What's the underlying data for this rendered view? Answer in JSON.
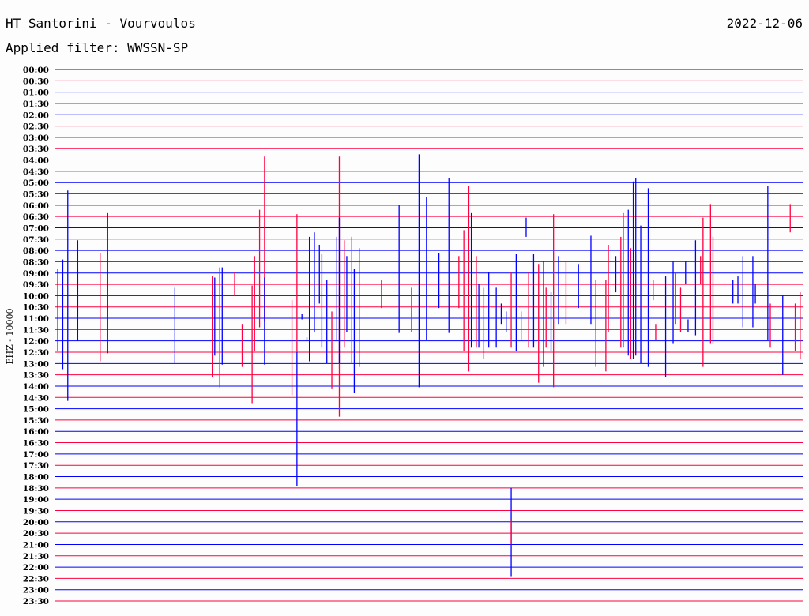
{
  "header": {
    "station": "HT Santorini - Vourvoulos",
    "date": "2022-12-06",
    "filter": "Applied filter: WWSSN-SP"
  },
  "colors": {
    "b": "#0000ff",
    "r": "#ff0040"
  },
  "chart_data": {
    "type": "helicorder",
    "ylabel": "EHZ - 10000",
    "minutes_per_line": 30,
    "tick_labels": [
      "00:00",
      "00:30",
      "01:00",
      "01:30",
      "02:00",
      "02:30",
      "03:00",
      "03:30",
      "04:00",
      "04:30",
      "05:00",
      "05:30",
      "06:00",
      "06:30",
      "07:00",
      "07:30",
      "08:00",
      "08:30",
      "09:00",
      "09:30",
      "10:00",
      "10:30",
      "11:00",
      "11:30",
      "12:00",
      "12:30",
      "13:00",
      "13:30",
      "14:00",
      "14:30",
      "15:00",
      "15:30",
      "16:00",
      "16:30",
      "17:00",
      "17:30",
      "18:00",
      "18:30",
      "19:00",
      "19:30",
      "20:00",
      "20:30",
      "21:00",
      "21:30",
      "22:00",
      "22:30",
      "23:00",
      "23:30"
    ],
    "trace_colors": [
      "b",
      "r"
    ],
    "spikes_note": "[minute within line, top, bottom (in trace-line units from 00:00), color]",
    "spikes": [
      [
        0.1,
        17.6,
        24.9,
        "b"
      ],
      [
        0.3,
        16.8,
        26.5,
        "b"
      ],
      [
        0.5,
        10.7,
        29.3,
        "b"
      ],
      [
        0.9,
        17.6,
        21.8,
        "b"
      ],
      [
        0.9,
        15.1,
        24.0,
        "b"
      ],
      [
        1.8,
        16.2,
        25.8,
        "r"
      ],
      [
        2.1,
        12.7,
        25.1,
        "b"
      ],
      [
        4.8,
        19.3,
        26.0,
        "b"
      ],
      [
        6.3,
        18.3,
        27.2,
        "r"
      ],
      [
        6.4,
        18.4,
        25.3,
        "b"
      ],
      [
        6.6,
        17.5,
        28.1,
        "r"
      ],
      [
        6.7,
        17.5,
        26.1,
        "b"
      ],
      [
        7.2,
        17.9,
        20.0,
        "r"
      ],
      [
        7.5,
        22.5,
        26.3,
        "r"
      ],
      [
        7.9,
        19.1,
        29.5,
        "r"
      ],
      [
        8.0,
        16.5,
        24.9,
        "r"
      ],
      [
        8.2,
        12.4,
        22.8,
        "r"
      ],
      [
        8.4,
        7.7,
        22.3,
        "r"
      ],
      [
        8.4,
        18.4,
        26.1,
        "b"
      ],
      [
        9.5,
        20.4,
        28.8,
        "r"
      ],
      [
        9.7,
        12.8,
        25.0,
        "r"
      ],
      [
        9.7,
        25.0,
        36.8,
        "b"
      ],
      [
        9.9,
        21.6,
        22.1,
        "b"
      ],
      [
        10.1,
        23.7,
        24.0,
        "b"
      ],
      [
        10.2,
        14.8,
        25.8,
        "b"
      ],
      [
        10.4,
        14.4,
        23.2,
        "b"
      ],
      [
        10.6,
        15.5,
        20.7,
        "b"
      ],
      [
        10.7,
        16.3,
        24.6,
        "b"
      ],
      [
        10.9,
        18.6,
        26.0,
        "b"
      ],
      [
        11.1,
        21.4,
        28.2,
        "r"
      ],
      [
        11.3,
        14.8,
        23.9,
        "b"
      ],
      [
        11.4,
        7.7,
        30.7,
        "r"
      ],
      [
        11.4,
        13.1,
        26.0,
        "b"
      ],
      [
        11.6,
        15.1,
        24.6,
        "r"
      ],
      [
        11.7,
        16.5,
        23.2,
        "b"
      ],
      [
        11.9,
        14.8,
        26.0,
        "r"
      ],
      [
        12.0,
        17.6,
        28.6,
        "b"
      ],
      [
        12.2,
        15.8,
        26.3,
        "b"
      ],
      [
        13.1,
        18.6,
        21.1,
        "b"
      ],
      [
        13.8,
        12.0,
        23.3,
        "b"
      ],
      [
        14.3,
        19.3,
        23.2,
        "r"
      ],
      [
        14.6,
        7.5,
        28.1,
        "b"
      ],
      [
        14.9,
        11.3,
        23.9,
        "b"
      ],
      [
        15.4,
        16.2,
        21.1,
        "b"
      ],
      [
        15.8,
        9.6,
        23.3,
        "b"
      ],
      [
        16.2,
        16.5,
        21.1,
        "r"
      ],
      [
        16.4,
        14.2,
        24.9,
        "r"
      ],
      [
        16.6,
        10.3,
        26.7,
        "r"
      ],
      [
        16.7,
        12.7,
        24.6,
        "b"
      ],
      [
        16.9,
        16.5,
        24.6,
        "r"
      ],
      [
        17.0,
        19.0,
        24.6,
        "b"
      ],
      [
        17.2,
        19.3,
        25.6,
        "b"
      ],
      [
        17.4,
        17.9,
        24.6,
        "b"
      ],
      [
        17.7,
        19.3,
        24.6,
        "b"
      ],
      [
        17.9,
        20.7,
        22.5,
        "b"
      ],
      [
        18.1,
        21.4,
        23.2,
        "b"
      ],
      [
        18.3,
        17.9,
        24.6,
        "r"
      ],
      [
        18.3,
        37.0,
        44.8,
        "b"
      ],
      [
        18.3,
        39.9,
        42.0,
        "r"
      ],
      [
        18.5,
        16.3,
        24.9,
        "b"
      ],
      [
        18.7,
        21.4,
        23.9,
        "r"
      ],
      [
        18.9,
        13.1,
        14.8,
        "b"
      ],
      [
        19.0,
        17.9,
        24.6,
        "r"
      ],
      [
        19.2,
        16.3,
        24.6,
        "b"
      ],
      [
        19.4,
        17.2,
        27.7,
        "r"
      ],
      [
        19.6,
        16.9,
        26.3,
        "b"
      ],
      [
        19.7,
        19.3,
        24.6,
        "r"
      ],
      [
        19.9,
        19.7,
        24.9,
        "b"
      ],
      [
        20.0,
        12.8,
        28.1,
        "r"
      ],
      [
        20.2,
        16.5,
        22.5,
        "b"
      ],
      [
        20.5,
        16.9,
        22.5,
        "r"
      ],
      [
        21.0,
        17.2,
        21.1,
        "b"
      ],
      [
        21.5,
        14.7,
        22.5,
        "b"
      ],
      [
        21.7,
        18.6,
        26.3,
        "b"
      ],
      [
        22.1,
        18.6,
        26.7,
        "r"
      ],
      [
        22.2,
        15.5,
        23.2,
        "r"
      ],
      [
        22.5,
        16.5,
        19.7,
        "b"
      ],
      [
        22.7,
        14.8,
        24.6,
        "r"
      ],
      [
        22.8,
        12.7,
        24.6,
        "r"
      ],
      [
        23.0,
        12.4,
        25.3,
        "b"
      ],
      [
        23.1,
        15.8,
        25.6,
        "r"
      ],
      [
        23.2,
        9.9,
        25.6,
        "b"
      ],
      [
        23.3,
        9.6,
        25.3,
        "b"
      ],
      [
        23.5,
        13.8,
        26.0,
        "b"
      ],
      [
        23.8,
        10.5,
        26.3,
        "b"
      ],
      [
        24.0,
        18.6,
        20.4,
        "r"
      ],
      [
        24.1,
        22.5,
        23.9,
        "r"
      ],
      [
        24.5,
        18.3,
        27.2,
        "b"
      ],
      [
        24.8,
        16.9,
        24.2,
        "b"
      ],
      [
        24.9,
        17.9,
        22.5,
        "r"
      ],
      [
        25.1,
        19.3,
        23.2,
        "r"
      ],
      [
        25.3,
        16.9,
        19.0,
        "b"
      ],
      [
        25.4,
        22.1,
        23.2,
        "b"
      ],
      [
        25.7,
        15.1,
        23.5,
        "b"
      ],
      [
        25.9,
        16.5,
        19.0,
        "r"
      ],
      [
        26.0,
        13.1,
        26.3,
        "r"
      ],
      [
        26.3,
        11.9,
        24.2,
        "r"
      ],
      [
        26.4,
        14.8,
        24.2,
        "r"
      ],
      [
        27.2,
        18.6,
        20.7,
        "b"
      ],
      [
        27.4,
        18.3,
        20.7,
        "b"
      ],
      [
        27.6,
        16.5,
        22.8,
        "b"
      ],
      [
        28.0,
        16.5,
        22.8,
        "b"
      ],
      [
        28.1,
        19.0,
        20.7,
        "b"
      ],
      [
        28.6,
        10.3,
        23.9,
        "b"
      ],
      [
        28.7,
        20.7,
        24.6,
        "r"
      ],
      [
        29.2,
        20.0,
        27.0,
        "b"
      ],
      [
        29.5,
        11.9,
        14.4,
        "r"
      ],
      [
        29.7,
        20.7,
        24.9,
        "r"
      ],
      [
        29.9,
        19.7,
        25.6,
        "r"
      ]
    ]
  }
}
